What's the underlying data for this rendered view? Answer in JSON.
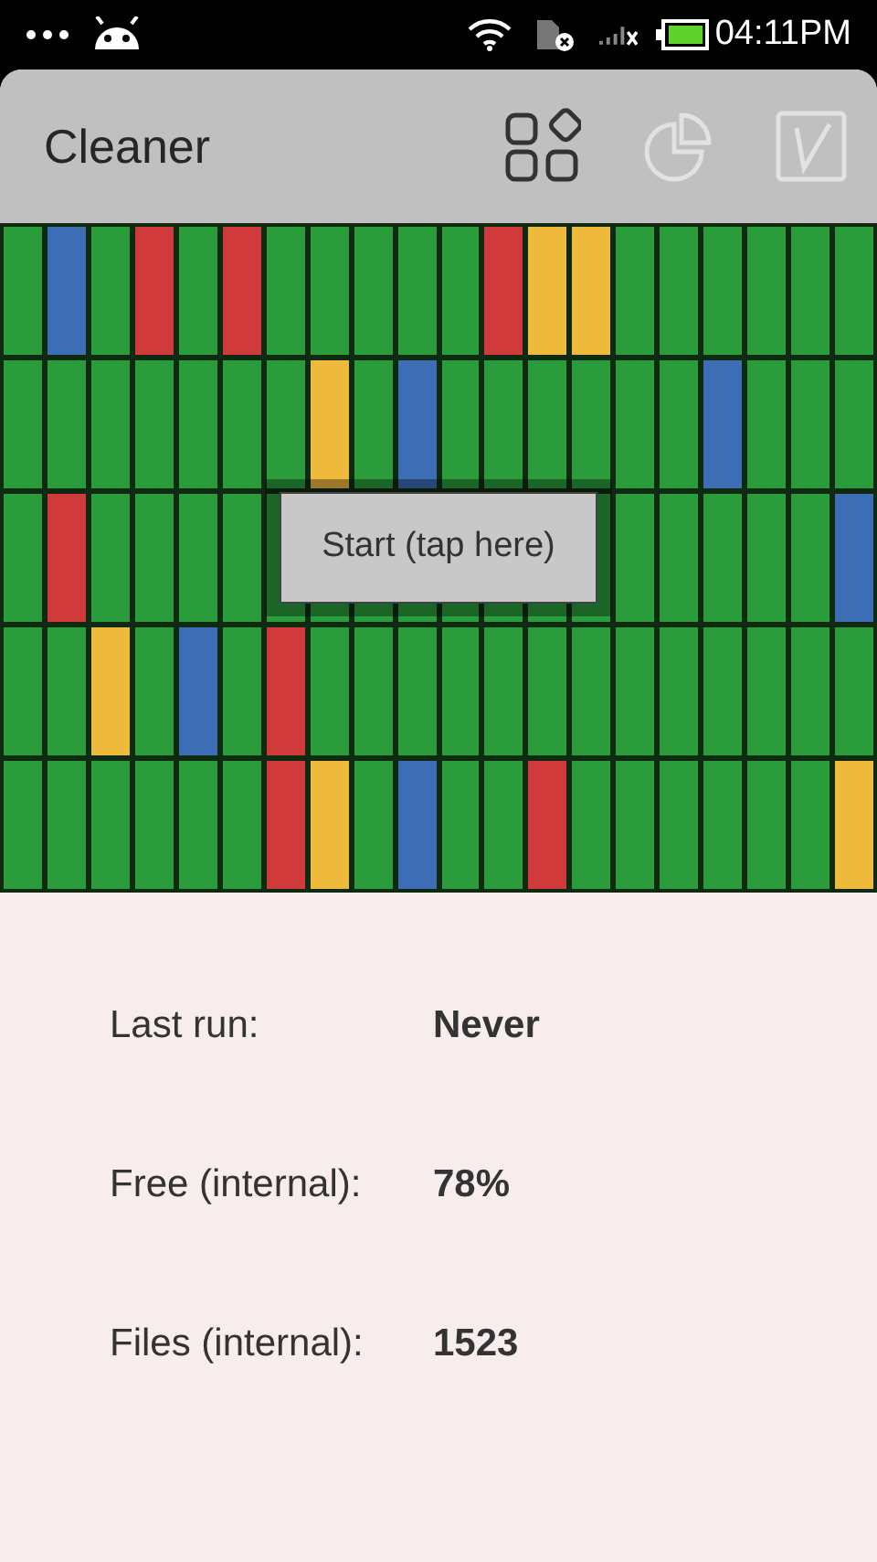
{
  "status_bar": {
    "time": "04:11PM"
  },
  "app_bar": {
    "title": "Cleaner",
    "actions": [
      {
        "kind": "apps",
        "disabled": false
      },
      {
        "kind": "pie",
        "disabled": true
      },
      {
        "kind": "check",
        "disabled": true
      }
    ]
  },
  "grid": {
    "rows": [
      {
        "cells": [
          {
            "color": "#2a9c3b"
          },
          {
            "color": "#3d6db5"
          },
          {
            "color": "#2a9c3b"
          },
          {
            "color": "#d13a3a"
          },
          {
            "color": "#2a9c3b"
          },
          {
            "color": "#d13a3a"
          },
          {
            "color": "#2a9c3b"
          },
          {
            "color": "#2a9c3b"
          },
          {
            "color": "#2a9c3b"
          },
          {
            "color": "#2a9c3b"
          },
          {
            "color": "#2a9c3b"
          },
          {
            "color": "#d13a3a"
          },
          {
            "color": "#efb93c"
          },
          {
            "color": "#efb93c"
          },
          {
            "color": "#2a9c3b"
          },
          {
            "color": "#2a9c3b"
          },
          {
            "color": "#2a9c3b"
          },
          {
            "color": "#2a9c3b"
          },
          {
            "color": "#2a9c3b"
          },
          {
            "color": "#2a9c3b"
          }
        ]
      },
      {
        "cells": [
          {
            "color": "#2a9c3b"
          },
          {
            "color": "#2a9c3b"
          },
          {
            "color": "#2a9c3b"
          },
          {
            "color": "#2a9c3b"
          },
          {
            "color": "#2a9c3b"
          },
          {
            "color": "#2a9c3b"
          },
          {
            "color": "#2a9c3b"
          },
          {
            "color": "#efb93c"
          },
          {
            "color": "#2a9c3b"
          },
          {
            "color": "#3d6db5"
          },
          {
            "color": "#2a9c3b"
          },
          {
            "color": "#2a9c3b"
          },
          {
            "color": "#2a9c3b"
          },
          {
            "color": "#2a9c3b"
          },
          {
            "color": "#2a9c3b"
          },
          {
            "color": "#2a9c3b"
          },
          {
            "color": "#3d6db5"
          },
          {
            "color": "#2a9c3b"
          },
          {
            "color": "#2a9c3b"
          },
          {
            "color": "#2a9c3b"
          }
        ]
      },
      {
        "cells": [
          {
            "color": "#2a9c3b"
          },
          {
            "color": "#d13a3a"
          },
          {
            "color": "#2a9c3b"
          },
          {
            "color": "#2a9c3b"
          },
          {
            "color": "#2a9c3b"
          },
          {
            "color": "#2a9c3b"
          },
          {
            "color": "#2a9c3b"
          },
          {
            "color": "#2a9c3b"
          },
          {
            "color": "#2a9c3b"
          },
          {
            "color": "#2a9c3b"
          },
          {
            "color": "#2a9c3b"
          },
          {
            "color": "#2a9c3b"
          },
          {
            "color": "#2a9c3b"
          },
          {
            "color": "#2a9c3b"
          },
          {
            "color": "#2a9c3b"
          },
          {
            "color": "#2a9c3b"
          },
          {
            "color": "#2a9c3b"
          },
          {
            "color": "#2a9c3b"
          },
          {
            "color": "#2a9c3b"
          },
          {
            "color": "#3d6db5"
          }
        ]
      },
      {
        "cells": [
          {
            "color": "#2a9c3b"
          },
          {
            "color": "#2a9c3b"
          },
          {
            "color": "#efb93c"
          },
          {
            "color": "#2a9c3b"
          },
          {
            "color": "#3d6db5"
          },
          {
            "color": "#2a9c3b"
          },
          {
            "color": "#d13a3a"
          },
          {
            "color": "#2a9c3b"
          },
          {
            "color": "#2a9c3b"
          },
          {
            "color": "#2a9c3b"
          },
          {
            "color": "#2a9c3b"
          },
          {
            "color": "#2a9c3b"
          },
          {
            "color": "#2a9c3b"
          },
          {
            "color": "#2a9c3b"
          },
          {
            "color": "#2a9c3b"
          },
          {
            "color": "#2a9c3b"
          },
          {
            "color": "#2a9c3b"
          },
          {
            "color": "#2a9c3b"
          },
          {
            "color": "#2a9c3b"
          },
          {
            "color": "#2a9c3b"
          }
        ]
      },
      {
        "cells": [
          {
            "color": "#2a9c3b"
          },
          {
            "color": "#2a9c3b"
          },
          {
            "color": "#2a9c3b"
          },
          {
            "color": "#2a9c3b"
          },
          {
            "color": "#2a9c3b"
          },
          {
            "color": "#2a9c3b"
          },
          {
            "color": "#d13a3a"
          },
          {
            "color": "#efb93c"
          },
          {
            "color": "#2a9c3b"
          },
          {
            "color": "#3d6db5"
          },
          {
            "color": "#2a9c3b"
          },
          {
            "color": "#2a9c3b"
          },
          {
            "color": "#d13a3a"
          },
          {
            "color": "#2a9c3b"
          },
          {
            "color": "#2a9c3b"
          },
          {
            "color": "#2a9c3b"
          },
          {
            "color": "#2a9c3b"
          },
          {
            "color": "#2a9c3b"
          },
          {
            "color": "#2a9c3b"
          },
          {
            "color": "#efb93c"
          }
        ]
      }
    ],
    "start_button": "Start (tap here)"
  },
  "stats": [
    {
      "label": "Last run:",
      "value": "Never"
    },
    {
      "label": "Free (internal):",
      "value": "78%"
    },
    {
      "label": "Files (internal):",
      "value": "1523"
    }
  ]
}
